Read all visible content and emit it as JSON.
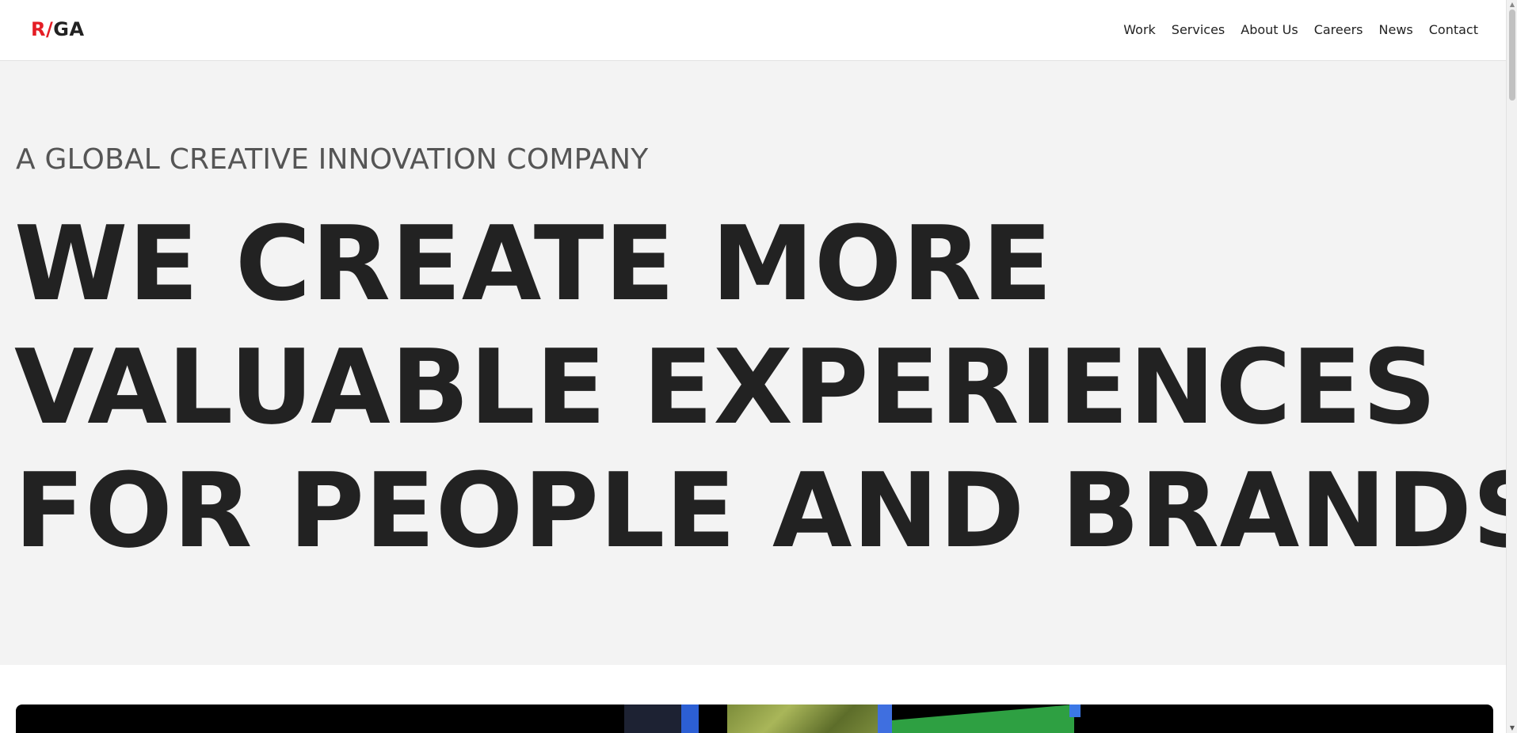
{
  "header": {
    "logo": {
      "r": "R",
      "slash": "/",
      "ga": "GA"
    },
    "nav": [
      {
        "label": "Work"
      },
      {
        "label": "Services"
      },
      {
        "label": "About Us"
      },
      {
        "label": "Careers"
      },
      {
        "label": "News"
      },
      {
        "label": "Contact"
      }
    ]
  },
  "hero": {
    "eyebrow": "A GLOBAL CREATIVE INNOVATION COMPANY",
    "headline_lines": [
      "WE CREATE MORE",
      "VALUABLE EXPERIENCES",
      "FOR PEOPLE AND BRANDS"
    ]
  },
  "scrollbar": {
    "up_icon": "triangle-up-icon",
    "down_icon": "triangle-down-icon",
    "up_glyph": "▲",
    "down_glyph": "▼"
  },
  "colors": {
    "brand_red": "#e41d25",
    "text_dark": "#222222",
    "hero_bg": "#f3f3f3"
  }
}
